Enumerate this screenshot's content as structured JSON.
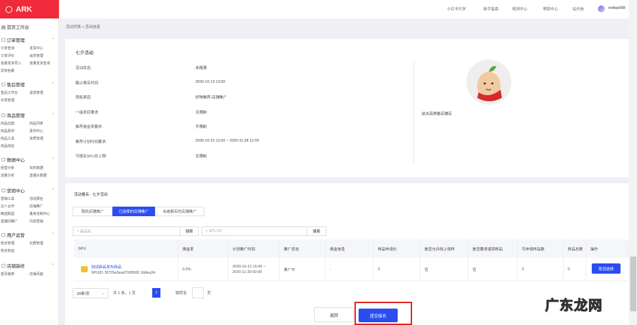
{
  "sidebar": {
    "logo": "ARK",
    "home": "首页工作台",
    "groups": [
      {
        "title": "订单管理",
        "items": [
          "订单查询",
          "发货中心",
          "订单评价",
          "运单管理",
          "批量发货导入",
          "批量发货查询",
          "异常包裹"
        ]
      },
      {
        "title": "售后管理",
        "items": [
          "售后工作台",
          "退货管理",
          "补发管理"
        ]
      },
      {
        "title": "商品管理",
        "items": [
          "商品创建",
          "商品列表",
          "商品素材",
          "素材中心",
          "商品工具",
          "资质管理",
          "商品体检"
        ]
      },
      {
        "title": "数据中心",
        "items": [
          "经营分析",
          "实时数据",
          "流量分析",
          "直播大数据"
        ]
      },
      {
        "title": "营销中心",
        "items": [
          "营销工具",
          "活动报名",
          "达人合作",
          "店铺推广",
          "精选联盟",
          "量身定制中心",
          "直播间推广",
          "内容营销"
        ]
      },
      {
        "title": "用户运营",
        "items": [
          "粉丝管理",
          "社群管理",
          "粉丝权益"
        ]
      },
      {
        "title": "店铺装修",
        "items": [
          "首页装修",
          "店铺页面"
        ]
      }
    ]
  },
  "header": {
    "nav": [
      "小红书大学",
      "新手指南",
      "规则中心",
      "帮助中心",
      "站内信"
    ],
    "username": "redtop008"
  },
  "breadcrumb": "活动列表 > 活动信息",
  "info": {
    "title": "七夕活动",
    "rows": [
      {
        "label": "活动状态:",
        "value": "未报满"
      },
      {
        "label": "截止报名时间:",
        "value": "2020-10-13 12:00"
      },
      {
        "label": "销售渠道:",
        "value": "好物推荐-店铺推广"
      },
      {
        "label": "一级类目要求:",
        "value": "无限制"
      },
      {
        "label": "推荐佣金率要求:",
        "value": "不限制"
      },
      {
        "label": "推荐计划时间要求:",
        "value": "2020-10-15 12:00 ~ 2020-11-28 12:00"
      },
      {
        "label": "可报名SPU总上限:",
        "value": "无限制"
      }
    ],
    "shop_link": "前去高燃看店铺店"
  },
  "signup": {
    "title": "活动报名 - 七夕活动",
    "tabs": [
      "我的店铺推广",
      "已选择的店铺推广",
      "未被报名的店铺推广"
    ],
    "search1_placeholder": "商品名",
    "search1_btn": "搜索",
    "search2_placeholder": "SPU ID",
    "search2_btn": "搜索",
    "columns": [
      "SPU",
      "佣金率",
      "计划推广时间",
      "推广状态",
      "佣金信息",
      "样品申请价",
      "是否允许线上领样",
      "是否要求退回样品",
      "可申请样品数",
      "样品总数",
      "操作"
    ],
    "row": {
      "name": "测试新品发布商品",
      "spuid": "SPUID: 5f725e3ead7180006 1b8ea34",
      "rate": "0.5%",
      "time1": "2020-10-12 15:40 ~",
      "time2": "2020-11-30 00:00",
      "status": "推广中",
      "commission": "-",
      "sample_price": "0",
      "online": "否",
      "return": "否",
      "available": "0",
      "total": "0",
      "action": "取消选择"
    },
    "pagination": {
      "page_size": "20条/页",
      "total": "共 1 条，1 页",
      "current": "1",
      "goto_label": "跳转至",
      "page_unit": "页"
    }
  },
  "footer": {
    "back": "返回",
    "submit": "提交报名"
  },
  "watermark": "广东龙网"
}
